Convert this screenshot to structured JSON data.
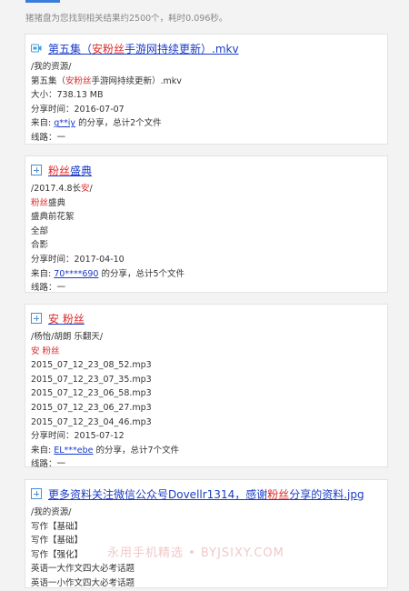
{
  "summary": "猪猪盘为您找到相关结果约2500个，耗时0.096秒。",
  "results": [
    {
      "title_pre": "第五集（",
      "title_hl": "安粉丝",
      "title_post": "手游网持续更新）.mkv",
      "icon": "video-file-icon",
      "path": "/我的资源/",
      "filename_pre": "第五集（",
      "filename_hl": "安粉丝",
      "filename_post": "手游网持续更新）.mkv",
      "size": "大小：738.13 MB",
      "share_time": "分享时间：2016-07-07",
      "from_prefix": "来自:",
      "uploader": "g**iy",
      "from_suffix": "的分享，总计2个文件",
      "route": "线路：一"
    },
    {
      "title_hl": "粉丝",
      "title_post": "盛典",
      "icon": "expand-plus-icon",
      "path_pre": "/2017.4.8长",
      "path_hl": "安",
      "path_post": "/",
      "files_first_hl": "粉丝",
      "files_first_post": "盛典",
      "files": [
        "盛典前花絮",
        "全部",
        "合影"
      ],
      "share_time": "分享时间：2017-04-10",
      "from_prefix": "来自:",
      "uploader": "70****690",
      "from_suffix": "的分享，总计5个文件",
      "route": "线路：一"
    },
    {
      "title_hl": "安 粉丝",
      "icon": "expand-plus-icon",
      "path": "/杨怡/胡朗 乐翻天/",
      "files_first_hl": "安 粉丝",
      "files": [
        "2015_07_12_23_08_52.mp3",
        "2015_07_12_23_07_35.mp3",
        "2015_07_12_23_06_58.mp3",
        "2015_07_12_23_06_27.mp3",
        "2015_07_12_23_04_46.mp3"
      ],
      "share_time": "分享时间：2015-07-12",
      "from_prefix": "来自:",
      "uploader": "EL***ebe",
      "from_suffix": "的分享，总计7个文件",
      "route": "线路：一"
    },
    {
      "title_pre": "更多资料关注微信公众号Dovellr1314，感谢",
      "title_hl": "粉丝",
      "title_post": "分享的资料.jpg",
      "icon": "expand-plus-icon",
      "path": "/我的资源/",
      "files": [
        "写作【基础】",
        "写作【基础】",
        "写作【强化】",
        "英语一大作文四大必考话题",
        "英语一小作文四大必考话题"
      ]
    }
  ],
  "watermark": "永用手机精选 • BYJSIXY.COM",
  "colors": {
    "link": "#1a3cc8",
    "highlight": "#e0292b",
    "accent": "#3b7ddd"
  }
}
